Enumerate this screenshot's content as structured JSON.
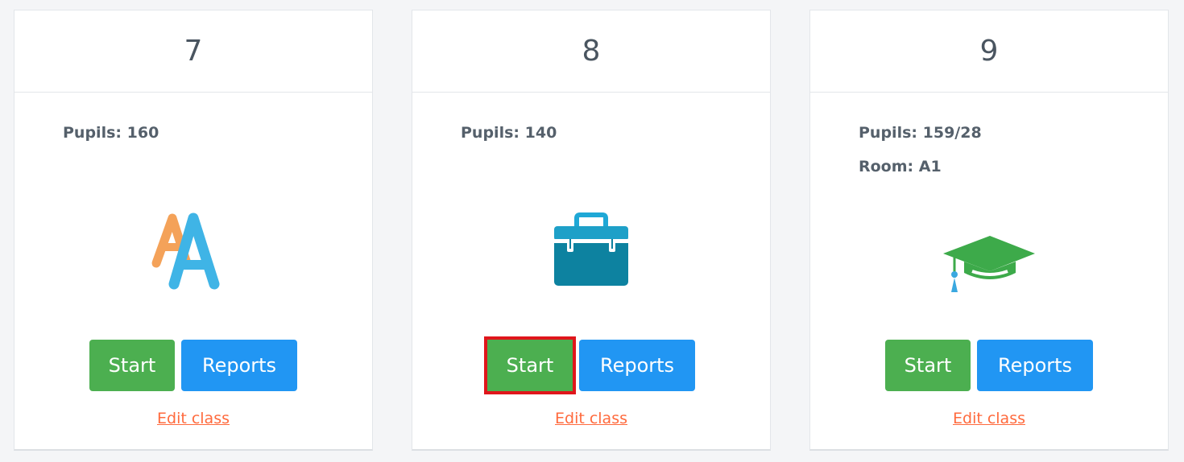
{
  "classes": [
    {
      "grade": "7",
      "pupils_label": "Pupils:",
      "pupils_value": "160",
      "icon": "alphabet-aa-icon",
      "start_label": "Start",
      "reports_label": "Reports",
      "edit_label": "Edit class"
    },
    {
      "grade": "8",
      "pupils_label": "Pupils:",
      "pupils_value": "140",
      "icon": "toolbox-icon",
      "start_label": "Start",
      "start_highlighted": true,
      "reports_label": "Reports",
      "edit_label": "Edit class"
    },
    {
      "grade": "9",
      "pupils_label": "Pupils:",
      "pupils_value": "159/28",
      "room_label": "Room:",
      "room_value": "A1",
      "icon": "graduation-cap-icon",
      "start_label": "Start",
      "reports_label": "Reports",
      "edit_label": "Edit class"
    }
  ],
  "colors": {
    "start": "#4caf50",
    "reports": "#2196f3",
    "edit_link": "#ff6a3d",
    "highlight": "#e0161b"
  }
}
